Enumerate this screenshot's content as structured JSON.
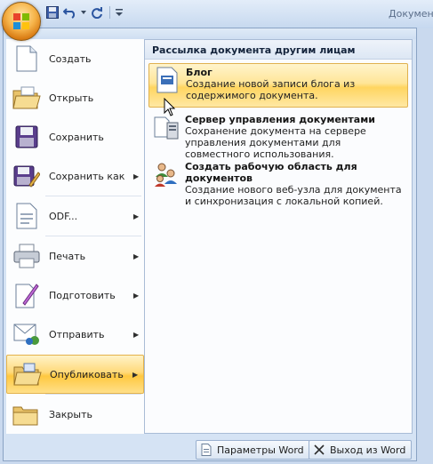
{
  "window": {
    "title": "Документ"
  },
  "qat": {
    "buttons": [
      {
        "icon": "save-icon"
      },
      {
        "icon": "undo-icon"
      },
      {
        "icon": "redo-icon"
      },
      {
        "icon": "customize-qat-icon"
      }
    ]
  },
  "menu": {
    "items": [
      {
        "label": "Создать",
        "icon": "new-document-icon",
        "has_submenu": false
      },
      {
        "label": "Открыть",
        "icon": "open-folder-icon",
        "has_submenu": false
      },
      {
        "label": "Сохранить",
        "icon": "save-floppy-icon",
        "has_submenu": false
      },
      {
        "label": "Сохранить как",
        "icon": "save-as-icon",
        "has_submenu": true
      },
      {
        "label": "ODF...",
        "icon": "odf-icon",
        "has_submenu": true
      },
      {
        "label": "Печать",
        "icon": "printer-icon",
        "has_submenu": true
      },
      {
        "label": "Подготовить",
        "icon": "prepare-icon",
        "has_submenu": true
      },
      {
        "label": "Отправить",
        "icon": "send-icon",
        "has_submenu": true
      },
      {
        "label": "Опубликовать",
        "icon": "publish-folder-icon",
        "has_submenu": true,
        "active": true
      },
      {
        "label": "Закрыть",
        "icon": "close-folder-icon",
        "has_submenu": false
      }
    ]
  },
  "submenu": {
    "header": "Рассылка документа другим лицам",
    "items": [
      {
        "title": "Блог",
        "description": "Создание новой записи блога из содержимого документа.",
        "icon": "blog-icon",
        "active": true
      },
      {
        "title": "Сервер управления документами",
        "description": "Сохранение документа на сервере управления документами для совместного использования.",
        "icon": "document-server-icon"
      },
      {
        "title": "Создать рабочую область для документов",
        "description": "Создание нового веб-узла для документа и синхронизация с локальной копией.",
        "icon": "workspace-users-icon"
      }
    ]
  },
  "footer": {
    "options_label": "Параметры Word",
    "exit_label": "Выход из Word"
  }
}
